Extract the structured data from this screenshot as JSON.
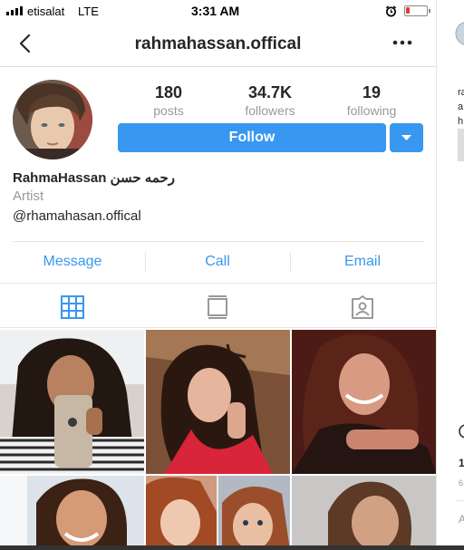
{
  "status_bar": {
    "carrier": "etisalat",
    "network": "LTE",
    "time": "3:31 AM"
  },
  "header": {
    "username": "rahmahassan.offical"
  },
  "profile": {
    "stats": [
      {
        "value": "180",
        "label": "posts"
      },
      {
        "value": "34.7K",
        "label": "followers"
      },
      {
        "value": "19",
        "label": "following"
      }
    ],
    "follow_label": "Follow",
    "display_name": "RahmaHassan رحمه حسن",
    "category": "Artist",
    "bio_handle": "@rhamahasan.offical"
  },
  "contact_actions": {
    "message": "Message",
    "call": "Call",
    "email": "Email"
  },
  "tabs": [
    "grid-icon",
    "feed-icon",
    "tagged-icon"
  ],
  "colors": {
    "accent": "#3897f0",
    "battery_low": "#e53935"
  },
  "right_strip": {
    "lines": [
      "ra",
      "a",
      "h"
    ],
    "footer": [
      "1",
      "6",
      "A"
    ]
  }
}
